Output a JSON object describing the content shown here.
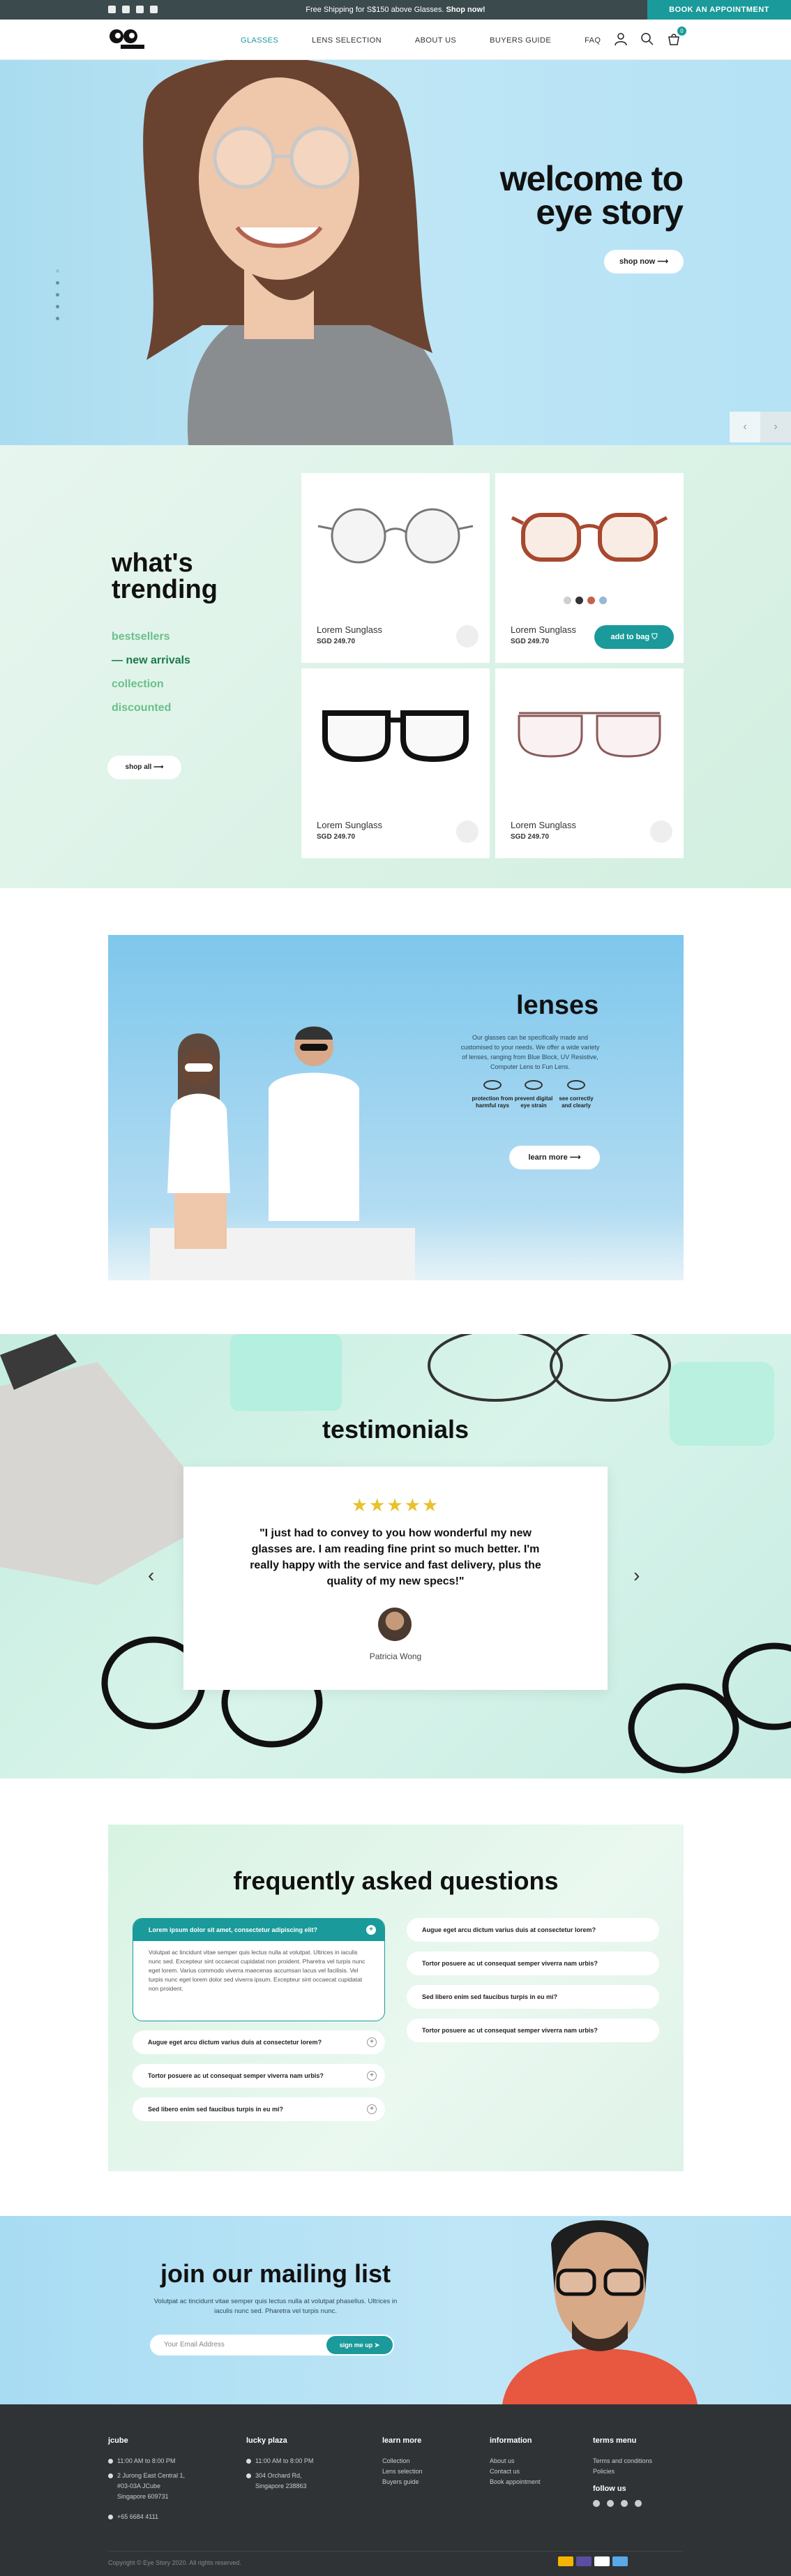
{
  "topbar": {
    "promo_text": "Free Shipping for S$150 above Glasses.",
    "promo_link": "Shop now!",
    "appointment_button": "BOOK AN APPOINTMENT",
    "social_icons": [
      "facebook-icon",
      "instagram-icon",
      "email-icon",
      "youtube-icon"
    ]
  },
  "header": {
    "logo_text": "eye story",
    "nav": [
      "GLASSES",
      "LENS SELECTION",
      "ABOUT US",
      "BUYERS GUIDE",
      "FAQ"
    ],
    "active_nav": "GLASSES",
    "cart_count": "0"
  },
  "hero": {
    "title_line1": "welcome to",
    "title_line2": "eye story",
    "button": "shop now"
  },
  "trending": {
    "title_line1": "what's",
    "title_line2": "trending",
    "menu": [
      "bestsellers",
      "new arrivals",
      "collection",
      "discounted"
    ],
    "active_menu": "new arrivals",
    "shop_all": "shop all",
    "products": [
      {
        "name": "Lorem Sunglass",
        "price": "SGD 249.70"
      },
      {
        "name": "Lorem Sunglass",
        "price": "SGD 249.70",
        "add_to_bag": "add to bag"
      },
      {
        "name": "Lorem Sunglass",
        "price": "SGD 249.70"
      },
      {
        "name": "Lorem Sunglass",
        "price": "SGD 249.70"
      }
    ],
    "swatch_colors": [
      "#cfcfcf",
      "#333333",
      "#c4624a",
      "#9ab6d8"
    ]
  },
  "lenses": {
    "title": "lenses",
    "text": "Our glasses can be specifically made and customised to your needs. We offer a wide variety of lenses, ranging from Blue Block, UV Resistive, Computer Lens to Fun Lens.",
    "features": [
      {
        "line1": "protection from",
        "line2": "harmful rays"
      },
      {
        "line1": "prevent digital",
        "line2": "eye strain"
      },
      {
        "line1": "see correctly",
        "line2": "and clearly"
      }
    ],
    "button": "learn more"
  },
  "testimonials": {
    "title": "testimonials",
    "stars": "★★★★★",
    "rating": 5,
    "quote": "\"I just had to convey to you how wonderful my new glasses are. I am reading fine print so much better. I'm really happy with the service and fast delivery, plus the quality of my new specs!\"",
    "name": "Patricia Wong"
  },
  "faq": {
    "title": "frequently asked questions",
    "open_question": "Lorem ipsum dolor sit amet, consectetur adipiscing elit?",
    "open_answer": "Volutpat ac tincidunt vitae semper quis lectus nulla at volutpat. Ultrices in iaculis nunc sed. Excepteur sint occaecat cupidatat non proident. Pharetra vel turpis nunc eget lorem. Varius commodo viverra maecenas accumsan lacus vel facilisis. Vel turpis nunc eget lorem dolor sed viverra ipsum. Excepteur sint occaecat cupidatat non proident.",
    "left_questions": [
      "Augue eget arcu dictum varius duis at consectetur lorem?",
      "Tortor posuere ac ut consequat semper viverra nam urbis?",
      "Sed libero enim sed faucibus turpis in eu mi?"
    ],
    "right_questions": [
      "Augue eget arcu dictum varius duis at consectetur lorem?",
      "Tortor posuere ac ut consequat semper viverra nam urbis?",
      "Sed libero enim sed faucibus turpis in eu mi?",
      "Tortor posuere ac ut consequat semper viverra nam urbis?"
    ]
  },
  "mailing": {
    "title": "join our mailing list",
    "text": "Volutpat ac tincidunt vitae semper quis lectus nulla at volutpat phasellus. Ultrices in iaculis nunc sed. Pharetra vel turpis nunc.",
    "placeholder": "Your Email Address",
    "button": "sign me up"
  },
  "footer": {
    "col1": {
      "title": "jcube",
      "hours": "11:00 AM to 8:00 PM",
      "address1": "2 Jurong East Central 1,",
      "address2": "#03-03A JCube",
      "address3": "Singapore 609731",
      "phone": "+65 6684 4111"
    },
    "col2": {
      "title": "lucky plaza",
      "hours": "11:00 AM to 8:00 PM",
      "address1": "304 Orchard Rd,",
      "address2": "Singapore 238863"
    },
    "col3": {
      "title": "learn more",
      "links": [
        "Collection",
        "Lens selection",
        "Buyers guide"
      ]
    },
    "col4": {
      "title": "information",
      "links": [
        "About us",
        "Contact us",
        "Book appointment"
      ]
    },
    "col5": {
      "title": "terms menu",
      "links": [
        "Terms and conditions",
        "Policies"
      ],
      "follow": "follow us"
    },
    "copyright": "Copyright © Eye Story 2020. All rights reserved.",
    "payment_colors": [
      "#f4b400",
      "#5b4ea0",
      "#ffffff",
      "#5aa9e6"
    ]
  }
}
